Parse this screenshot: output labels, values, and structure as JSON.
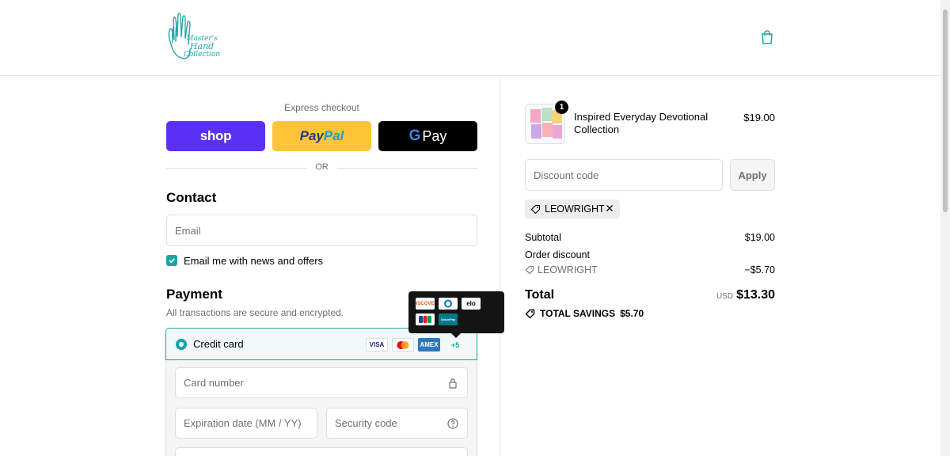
{
  "brand": {
    "logo_lines": [
      "Master's",
      "Hand",
      "Collection"
    ],
    "accent_color": "#1aa5a5"
  },
  "header": {
    "cart_icon": "shopping-bag-icon"
  },
  "express": {
    "label": "Express checkout",
    "shop_label": "shop",
    "paypal_part1": "Pay",
    "paypal_part2": "Pal",
    "gpay_g": "G",
    "gpay_label": "Pay",
    "or": "OR"
  },
  "contact": {
    "heading": "Contact",
    "email_placeholder": "Email",
    "newsletter_label": "Email me with news and offers",
    "newsletter_checked": true
  },
  "payment": {
    "heading": "Payment",
    "note": "All transactions are secure and encrypted.",
    "method_label": "Credit card",
    "cards": [
      "VISA",
      "MC",
      "AMEX"
    ],
    "more_cards": "+5",
    "tooltip_cards": [
      "DISCOVER",
      "DINERS",
      "elo",
      "JCB",
      "UnionPay"
    ],
    "card_number_placeholder": "Card number",
    "expiry_placeholder": "Expiration date (MM / YY)",
    "security_placeholder": "Security code"
  },
  "order": {
    "item_name": "Inspired Everyday Devotional Collection",
    "item_price": "$19.00",
    "item_qty": "1",
    "discount_placeholder": "Discount code",
    "apply_label": "Apply",
    "applied_code": "LEOWRIGHT",
    "subtotal_label": "Subtotal",
    "subtotal_value": "$19.00",
    "order_discount_label": "Order discount",
    "discount_code": "LEOWRIGHT",
    "discount_value": "−$5.70",
    "total_label": "Total",
    "currency": "USD",
    "total_value": "$13.30",
    "savings_label": "TOTAL SAVINGS",
    "savings_value": "$5.70"
  }
}
